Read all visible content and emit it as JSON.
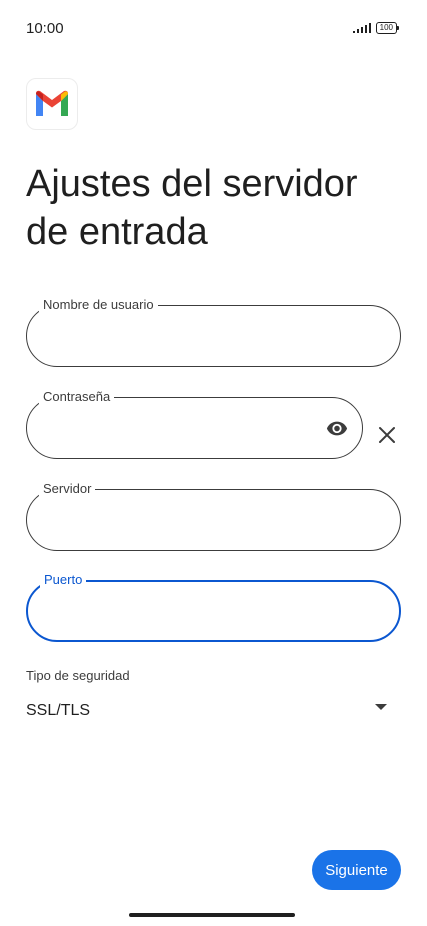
{
  "status_bar": {
    "time": "10:00",
    "battery": "100",
    "signal_icon": "signal-bars-icon",
    "battery_icon": "battery-icon"
  },
  "app": {
    "logo": "gmail-logo-icon"
  },
  "title": "Ajustes del servidor de entrada",
  "fields": {
    "username": {
      "label": "Nombre de usuario",
      "value": ""
    },
    "password": {
      "label": "Contraseña",
      "value": "",
      "toggle_icon": "eye-icon",
      "clear_icon": "close-icon"
    },
    "server": {
      "label": "Servidor",
      "value": ""
    },
    "port": {
      "label": "Puerto",
      "value": "",
      "focused": true
    }
  },
  "security": {
    "label": "Tipo de seguridad",
    "selected": "SSL/TLS",
    "icon": "dropdown-arrow-icon"
  },
  "actions": {
    "next_label": "Siguiente"
  },
  "colors": {
    "accent": "#0b57d0",
    "button": "#1a73e8",
    "text": "#1f1f1f",
    "border": "#3c3c3c"
  }
}
